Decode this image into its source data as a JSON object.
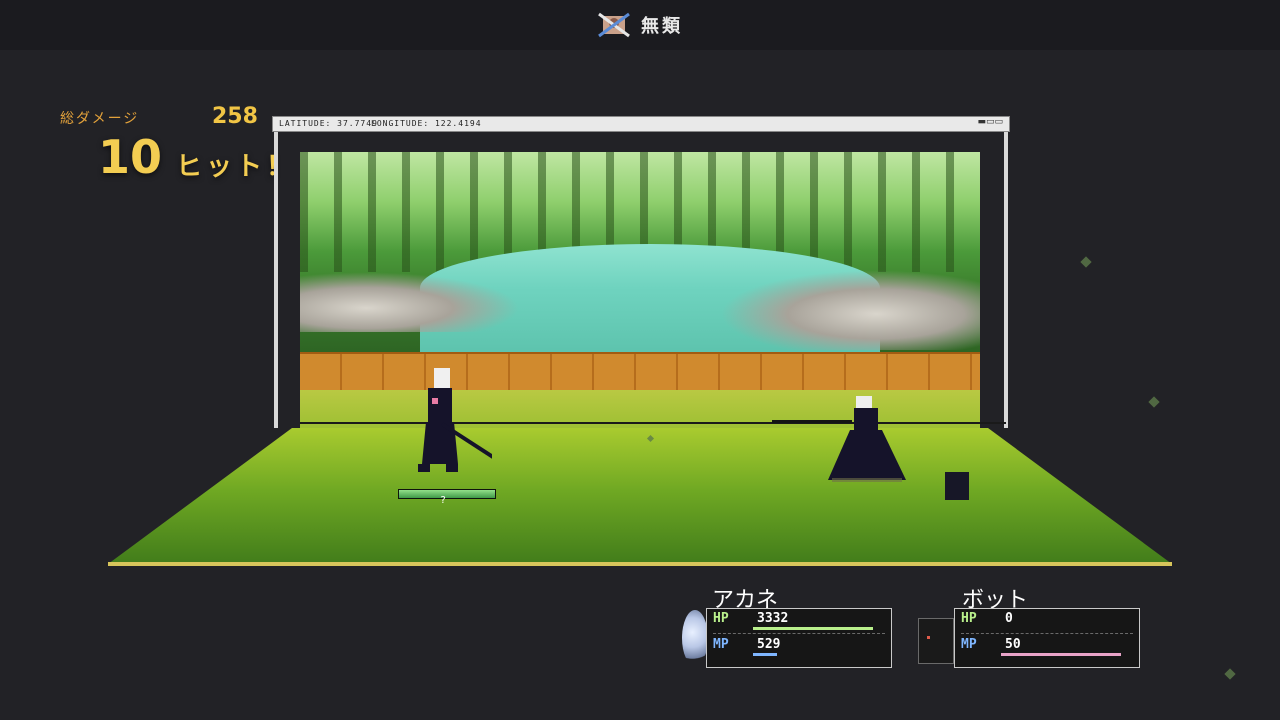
{
  "header": {
    "title": "無類",
    "icon": "crossed-portrait-icon"
  },
  "combo": {
    "damage_label": "総ダメージ",
    "damage_value": "258",
    "count": "10",
    "suffix": "ヒット！"
  },
  "stage": {
    "latitude_label": "LATITUDE: 37.7749",
    "longitude_label": "LONGITUDE: 122.4194",
    "window_controls": "▬▭▭",
    "scene_type": "forest-river"
  },
  "player": {
    "name": "アカネ",
    "hp_label": "HP",
    "hp_value": "3332",
    "mp_label": "MP",
    "mp_value": "529",
    "hp_fraction": 1.0,
    "mp_fraction": 0.2,
    "field_marker": "?",
    "colors": {
      "hp": "#b9f08c",
      "mp": "#7fb6ff"
    }
  },
  "enemy": {
    "name": "ボット",
    "hp_label": "HP",
    "hp_value": "0",
    "mp_label": "MP",
    "mp_value": "50",
    "hp_fraction": 0,
    "mp_fraction": 1.0,
    "colors": {
      "hp": "#b9f08c",
      "mp": "#e8a3c8"
    }
  }
}
